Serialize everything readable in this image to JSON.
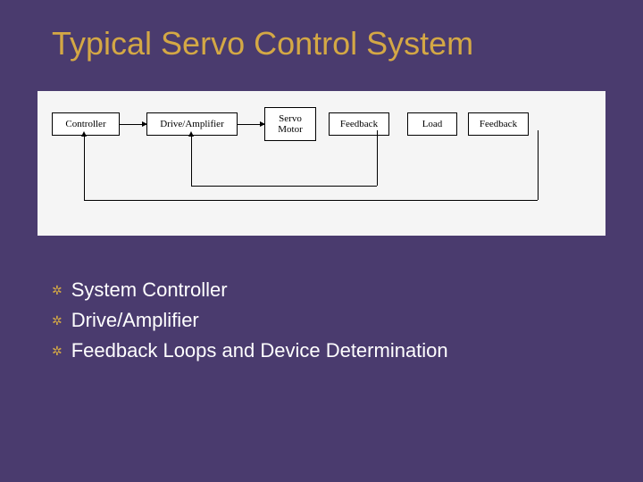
{
  "title": "Typical Servo Control System",
  "diagram": {
    "blocks": {
      "controller": "Controller",
      "drive": "Drive/Amplifier",
      "motor": "Servo\nMotor",
      "feedback1": "Feedback",
      "load": "Load",
      "feedback2": "Feedback"
    }
  },
  "bullets": [
    "System Controller",
    "Drive/Amplifier",
    "Feedback Loops and Device Determination"
  ]
}
